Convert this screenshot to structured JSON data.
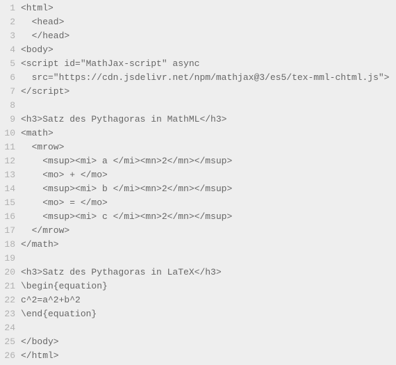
{
  "code": {
    "lines": [
      {
        "n": 1,
        "t": "<html>"
      },
      {
        "n": 2,
        "t": "  <head>"
      },
      {
        "n": 3,
        "t": "  </head>"
      },
      {
        "n": 4,
        "t": "<body>"
      },
      {
        "n": 5,
        "t": "<script id=\"MathJax-script\" async"
      },
      {
        "n": 6,
        "t": "  src=\"https://cdn.jsdelivr.net/npm/mathjax@3/es5/tex-mml-chtml.js\">"
      },
      {
        "n": 7,
        "t": "</script>"
      },
      {
        "n": 8,
        "t": ""
      },
      {
        "n": 9,
        "t": "<h3>Satz des Pythagoras in MathML</h3>"
      },
      {
        "n": 10,
        "t": "<math>"
      },
      {
        "n": 11,
        "t": "  <mrow>"
      },
      {
        "n": 12,
        "t": "    <msup><mi> a </mi><mn>2</mn></msup>"
      },
      {
        "n": 13,
        "t": "    <mo> + </mo>"
      },
      {
        "n": 14,
        "t": "    <msup><mi> b </mi><mn>2</mn></msup>"
      },
      {
        "n": 15,
        "t": "    <mo> = </mo>"
      },
      {
        "n": 16,
        "t": "    <msup><mi> c </mi><mn>2</mn></msup>"
      },
      {
        "n": 17,
        "t": "  </mrow>"
      },
      {
        "n": 18,
        "t": "</math>"
      },
      {
        "n": 19,
        "t": ""
      },
      {
        "n": 20,
        "t": "<h3>Satz des Pythagoras in LaTeX</h3>"
      },
      {
        "n": 21,
        "t": "\\begin{equation}"
      },
      {
        "n": 22,
        "t": "c^2=a^2+b^2"
      },
      {
        "n": 23,
        "t": "\\end{equation}"
      },
      {
        "n": 24,
        "t": ""
      },
      {
        "n": 25,
        "t": "</body>"
      },
      {
        "n": 26,
        "t": "</html>"
      }
    ]
  }
}
